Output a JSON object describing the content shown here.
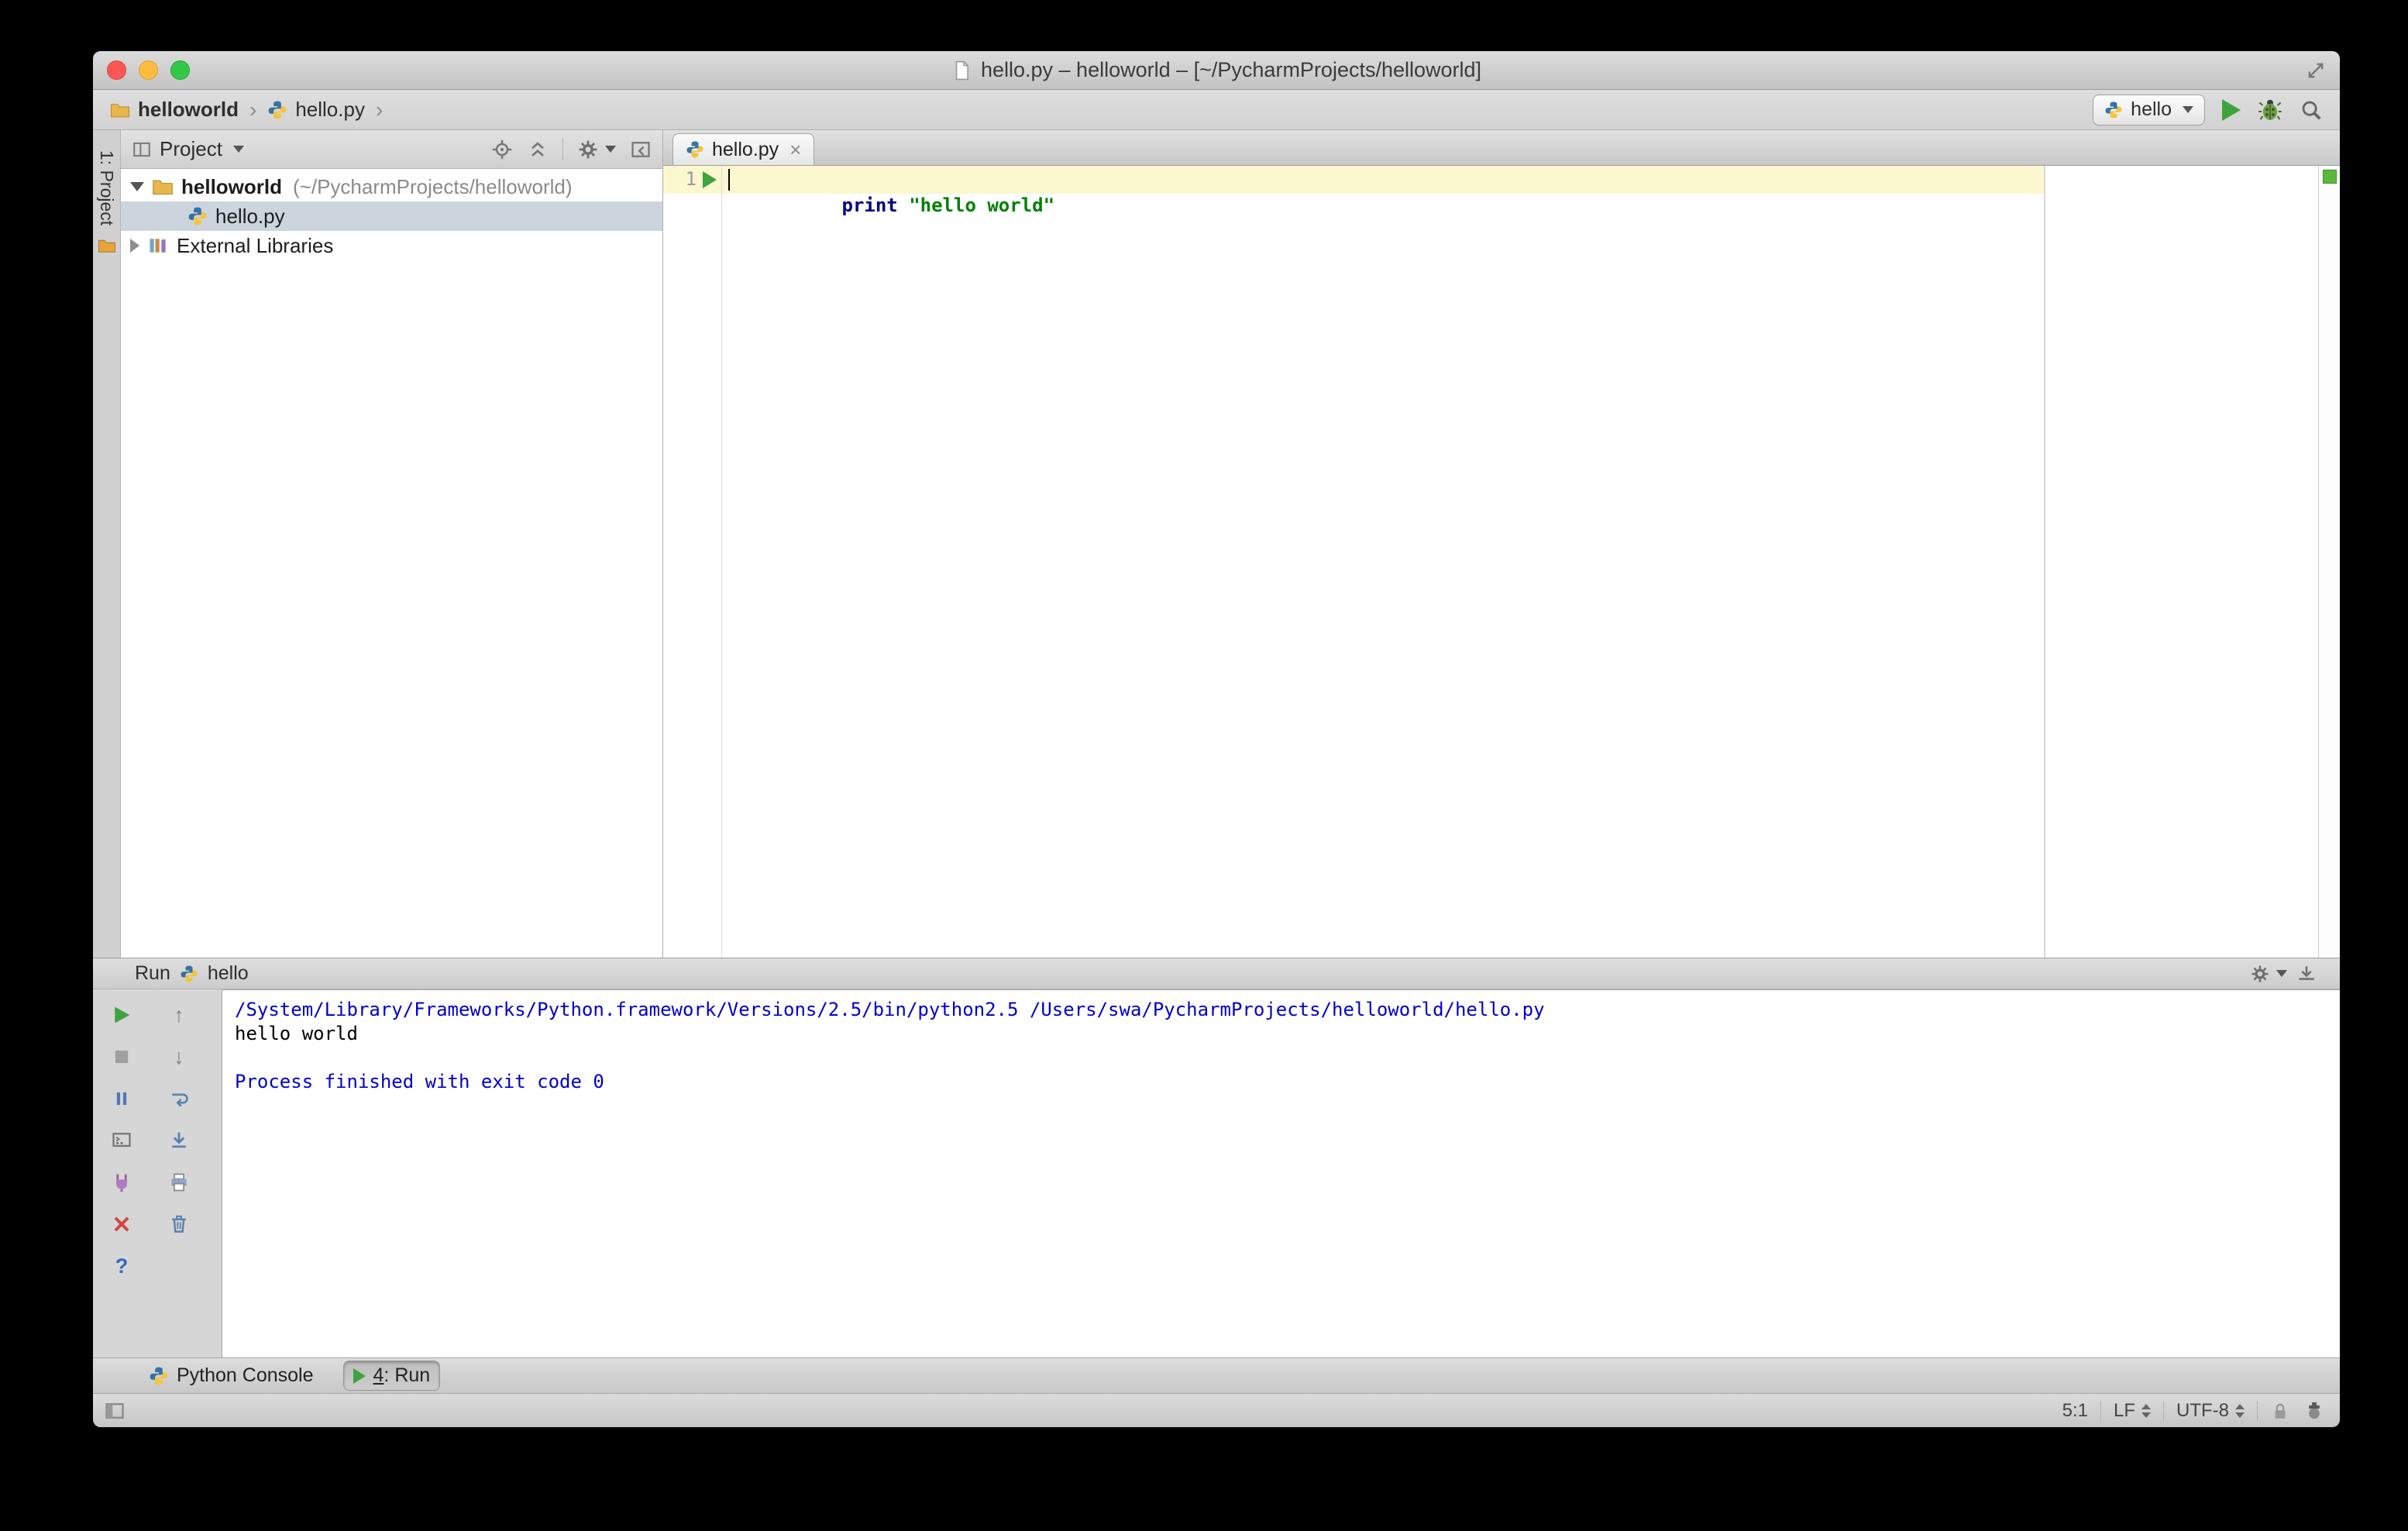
{
  "window": {
    "title": "hello.py – helloworld – [~/PycharmProjects/helloworld]"
  },
  "navbar": {
    "breadcrumb": {
      "project": "helloworld",
      "file": "hello.py"
    },
    "run_config_label": "hello"
  },
  "tool_stripe": {
    "project": "1: Project"
  },
  "project_panel": {
    "header_title": "Project",
    "tree": {
      "root_label": "helloworld",
      "root_path": "(~/PycharmProjects/helloworld)",
      "file_label": "hello.py",
      "libraries_label": "External Libraries"
    }
  },
  "editor": {
    "tab_label": "hello.py",
    "line_number": "1",
    "code": {
      "keyword": "print",
      "string": "\"hello world\""
    }
  },
  "run_panel": {
    "title": "Run",
    "config_label": "hello",
    "console": [
      {
        "text": "/System/Library/Frameworks/Python.framework/Versions/2.5/bin/python2.5 /Users/swa/PycharmProjects/helloworld/hello.py"
      },
      {
        "text": "hello world"
      },
      {
        "text": ""
      },
      {
        "text": "Process finished with exit code 0"
      }
    ]
  },
  "bottom_bar": {
    "python_console": "Python Console",
    "run_tab_number": "4",
    "run_tab_suffix": ": Run"
  },
  "status_bar": {
    "caret_position": "5:1",
    "line_separator": "LF",
    "encoding": "UTF-8"
  },
  "colors": {
    "keyword": "#000080",
    "string": "#008000",
    "console_info": "#0000cc",
    "run_green": "#3fa33f",
    "ok_indicator": "#5bb83b",
    "caret_row": "#fbf7cf",
    "selection": "#ccd4dd"
  }
}
